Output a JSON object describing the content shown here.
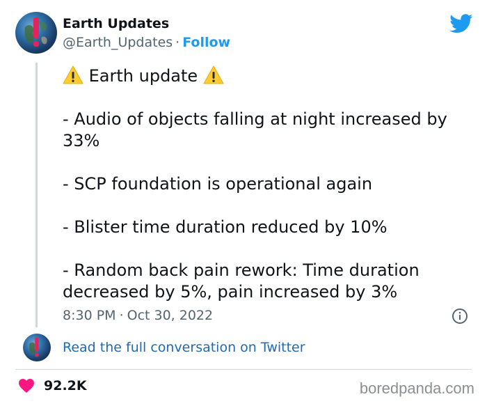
{
  "user": {
    "display_name": "Earth Updates",
    "handle": "@Earth_Updates",
    "separator": "·",
    "follow_label": "Follow",
    "avatar_icon": "earth-globe-exclamation-icon"
  },
  "tweet": {
    "lines": [
      "Earth update",
      "- Audio of objects falling at night increased by 33%",
      "- SCP foundation is operational again",
      "- Blister time duration reduced by 10%",
      "- Random back pain rework: Time duration decreased by 5%, pain increased by 3%"
    ],
    "time": "8:30 PM",
    "separator": "·",
    "date": "Oct 30, 2022"
  },
  "actions": {
    "read_link": "Read the full conversation on Twitter",
    "likes": "92.2K"
  },
  "watermark": "boredpanda.com",
  "colors": {
    "link_blue": "#1d9bf0",
    "muted_gray": "#536471",
    "heart_pink": "#f91880",
    "warning_yellow": "#ffcc32"
  }
}
